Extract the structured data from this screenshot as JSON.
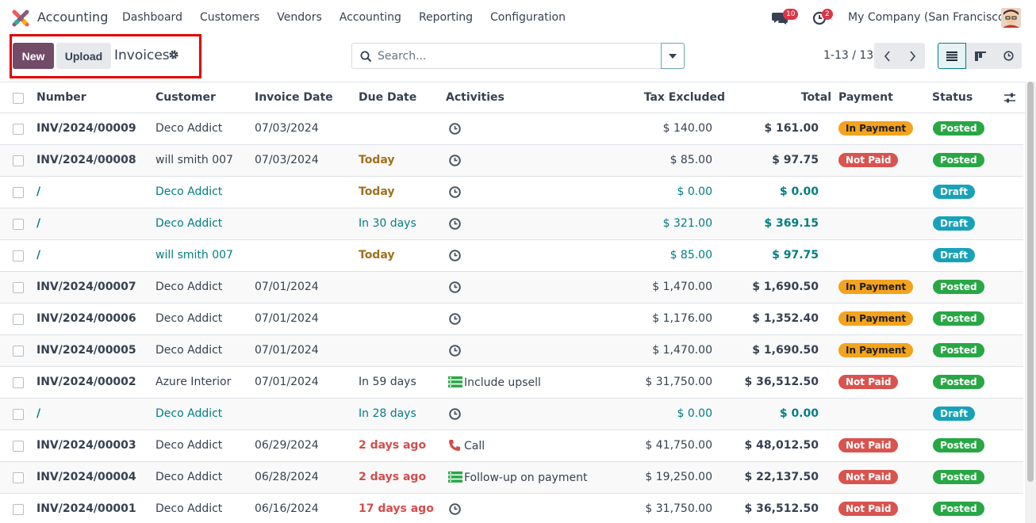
{
  "navbar": {
    "app_name": "Accounting",
    "menu": [
      "Dashboard",
      "Customers",
      "Vendors",
      "Accounting",
      "Reporting",
      "Configuration"
    ],
    "messages_count": "10",
    "activities_count": "2",
    "company": "My Company (San Francisco)"
  },
  "control": {
    "new_label": "New",
    "upload_label": "Upload",
    "breadcrumb": "Invoices",
    "search_placeholder": "Search...",
    "pager": "1-13 / 13"
  },
  "table": {
    "headers": {
      "number": "Number",
      "customer": "Customer",
      "invoice_date": "Invoice Date",
      "due_date": "Due Date",
      "activities": "Activities",
      "tax_excluded": "Tax Excluded",
      "total": "Total",
      "payment": "Payment",
      "status": "Status"
    },
    "rows": [
      {
        "number": "INV/2024/00009",
        "customer": "Deco Addict",
        "invoice_date": "07/03/2024",
        "due_date": "",
        "due_style": "plain",
        "activity": "",
        "activity_icon": "clock-icon",
        "tax_excluded": "$ 140.00",
        "total": "$ 161.00",
        "payment": "In Payment",
        "status": "Posted",
        "draft": false
      },
      {
        "number": "INV/2024/00008",
        "customer": "will smith 007",
        "invoice_date": "07/03/2024",
        "due_date": "Today",
        "due_style": "today",
        "activity": "",
        "activity_icon": "clock-icon",
        "tax_excluded": "$ 85.00",
        "total": "$ 97.75",
        "payment": "Not Paid",
        "status": "Posted",
        "draft": false
      },
      {
        "number": "/",
        "customer": "Deco Addict",
        "invoice_date": "",
        "due_date": "Today",
        "due_style": "today",
        "activity": "",
        "activity_icon": "clock-icon",
        "tax_excluded": "$ 0.00",
        "total": "$ 0.00",
        "payment": "",
        "status": "Draft",
        "draft": true
      },
      {
        "number": "/",
        "customer": "Deco Addict",
        "invoice_date": "",
        "due_date": "In 30 days",
        "due_style": "future",
        "activity": "",
        "activity_icon": "clock-icon",
        "tax_excluded": "$ 321.00",
        "total": "$ 369.15",
        "payment": "",
        "status": "Draft",
        "draft": true
      },
      {
        "number": "/",
        "customer": "will smith 007",
        "invoice_date": "",
        "due_date": "Today",
        "due_style": "today",
        "activity": "",
        "activity_icon": "clock-icon",
        "tax_excluded": "$ 85.00",
        "total": "$ 97.75",
        "payment": "",
        "status": "Draft",
        "draft": true
      },
      {
        "number": "INV/2024/00007",
        "customer": "Deco Addict",
        "invoice_date": "07/01/2024",
        "due_date": "",
        "due_style": "plain",
        "activity": "",
        "activity_icon": "clock-icon",
        "tax_excluded": "$ 1,470.00",
        "total": "$ 1,690.50",
        "payment": "In Payment",
        "status": "Posted",
        "draft": false
      },
      {
        "number": "INV/2024/00006",
        "customer": "Deco Addict",
        "invoice_date": "07/01/2024",
        "due_date": "",
        "due_style": "plain",
        "activity": "",
        "activity_icon": "clock-icon",
        "tax_excluded": "$ 1,176.00",
        "total": "$ 1,352.40",
        "payment": "In Payment",
        "status": "Posted",
        "draft": false
      },
      {
        "number": "INV/2024/00005",
        "customer": "Deco Addict",
        "invoice_date": "07/01/2024",
        "due_date": "",
        "due_style": "plain",
        "activity": "",
        "activity_icon": "clock-icon",
        "tax_excluded": "$ 1,470.00",
        "total": "$ 1,690.50",
        "payment": "In Payment",
        "status": "Posted",
        "draft": false
      },
      {
        "number": "INV/2024/00002",
        "customer": "Azure Interior",
        "invoice_date": "07/01/2024",
        "due_date": "In 59 days",
        "due_style": "plain",
        "activity": "Include upsell",
        "activity_icon": "todo-icon",
        "tax_excluded": "$ 31,750.00",
        "total": "$ 36,512.50",
        "payment": "Not Paid",
        "status": "Posted",
        "draft": false
      },
      {
        "number": "/",
        "customer": "Deco Addict",
        "invoice_date": "",
        "due_date": "In 28 days",
        "due_style": "future",
        "activity": "",
        "activity_icon": "clock-icon",
        "tax_excluded": "$ 0.00",
        "total": "$ 0.00",
        "payment": "",
        "status": "Draft",
        "draft": true
      },
      {
        "number": "INV/2024/00003",
        "customer": "Deco Addict",
        "invoice_date": "06/29/2024",
        "due_date": "2 days ago",
        "due_style": "overdue",
        "activity": "Call",
        "activity_icon": "phone-icon",
        "tax_excluded": "$ 41,750.00",
        "total": "$ 48,012.50",
        "payment": "Not Paid",
        "status": "Posted",
        "draft": false
      },
      {
        "number": "INV/2024/00004",
        "customer": "Deco Addict",
        "invoice_date": "06/28/2024",
        "due_date": "2 days ago",
        "due_style": "overdue",
        "activity": "Follow-up on payment",
        "activity_icon": "todo-icon",
        "tax_excluded": "$ 19,250.00",
        "total": "$ 22,137.50",
        "payment": "Not Paid",
        "status": "Posted",
        "draft": false
      },
      {
        "number": "INV/2024/00001",
        "customer": "Deco Addict",
        "invoice_date": "06/16/2024",
        "due_date": "17 days ago",
        "due_style": "overdue",
        "activity": "",
        "activity_icon": "clock-icon",
        "tax_excluded": "$ 31,750.00",
        "total": "$ 36,512.50",
        "payment": "Not Paid",
        "status": "Posted",
        "draft": false
      }
    ]
  },
  "colors": {
    "brand": "#714b67",
    "accent": "#017e84",
    "in_payment": "#f3a31d",
    "not_paid": "#d9534f",
    "posted": "#28a745",
    "draft": "#17a2b8",
    "highlight_box": "#e00000"
  }
}
